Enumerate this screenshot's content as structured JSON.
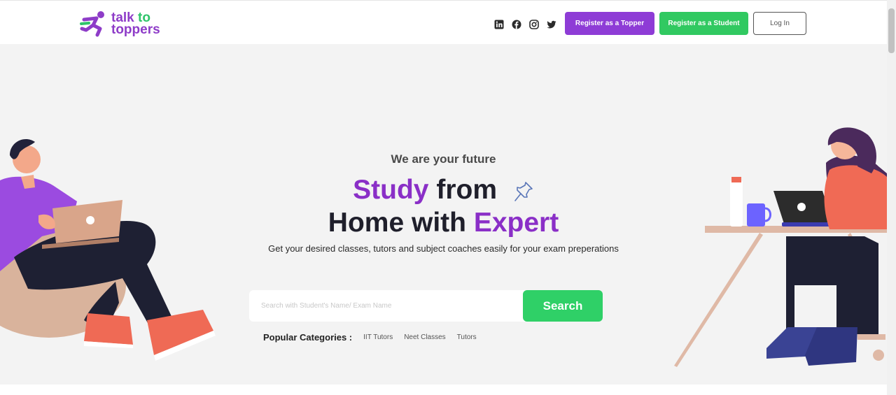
{
  "brand": {
    "line1": "talk",
    "line1_to": "to",
    "line2": "toppers",
    "accent": "#8e3cc8",
    "accent2": "#2fc46a"
  },
  "header": {
    "social_icons": [
      "linkedin-icon",
      "facebook-icon",
      "instagram-icon",
      "twitter-icon"
    ],
    "register_topper": "Register as a Topper",
    "register_student": "Register as a Student",
    "login": "Log In"
  },
  "hero": {
    "tagline": "We are your future",
    "headline_w1": "Study",
    "headline_w2": "from",
    "headline_w3": "Home with",
    "headline_w4": "Expert",
    "subtext": "Get your desired classes, tutors and subject coaches easily for your exam preperations",
    "search_placeholder": "Search with Student's Name/ Exam Name",
    "search_button": "Search",
    "categories_label": "Popular Categories :",
    "categories": [
      "IIT Tutors",
      "Neet Classes",
      "Tutors"
    ]
  },
  "colors": {
    "purple": "#8a2fc7",
    "green": "#2fd067",
    "hero_bg": "#f3f3f3"
  }
}
